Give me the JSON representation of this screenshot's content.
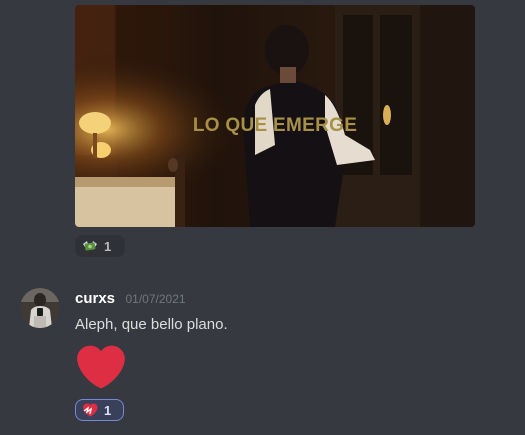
{
  "image_embed": {
    "caption": "LO QUE EMERGE"
  },
  "reactions": [
    {
      "emoji": "money-with-wings-emoji",
      "count": "1"
    },
    {
      "emoji": "heart-on-fire-emoji",
      "count": "1"
    }
  ],
  "message": {
    "username": "curxs",
    "timestamp": "01/07/2021",
    "text": "Aleph, que bello plano.",
    "big_emoji": "red-heart-emoji"
  },
  "colors": {
    "background": "#36393f",
    "username": "#ffffff",
    "timestamp": "#72767d",
    "reaction_active_border": "#7289da",
    "heart": "#dd2e44",
    "caption": "#a69147"
  }
}
